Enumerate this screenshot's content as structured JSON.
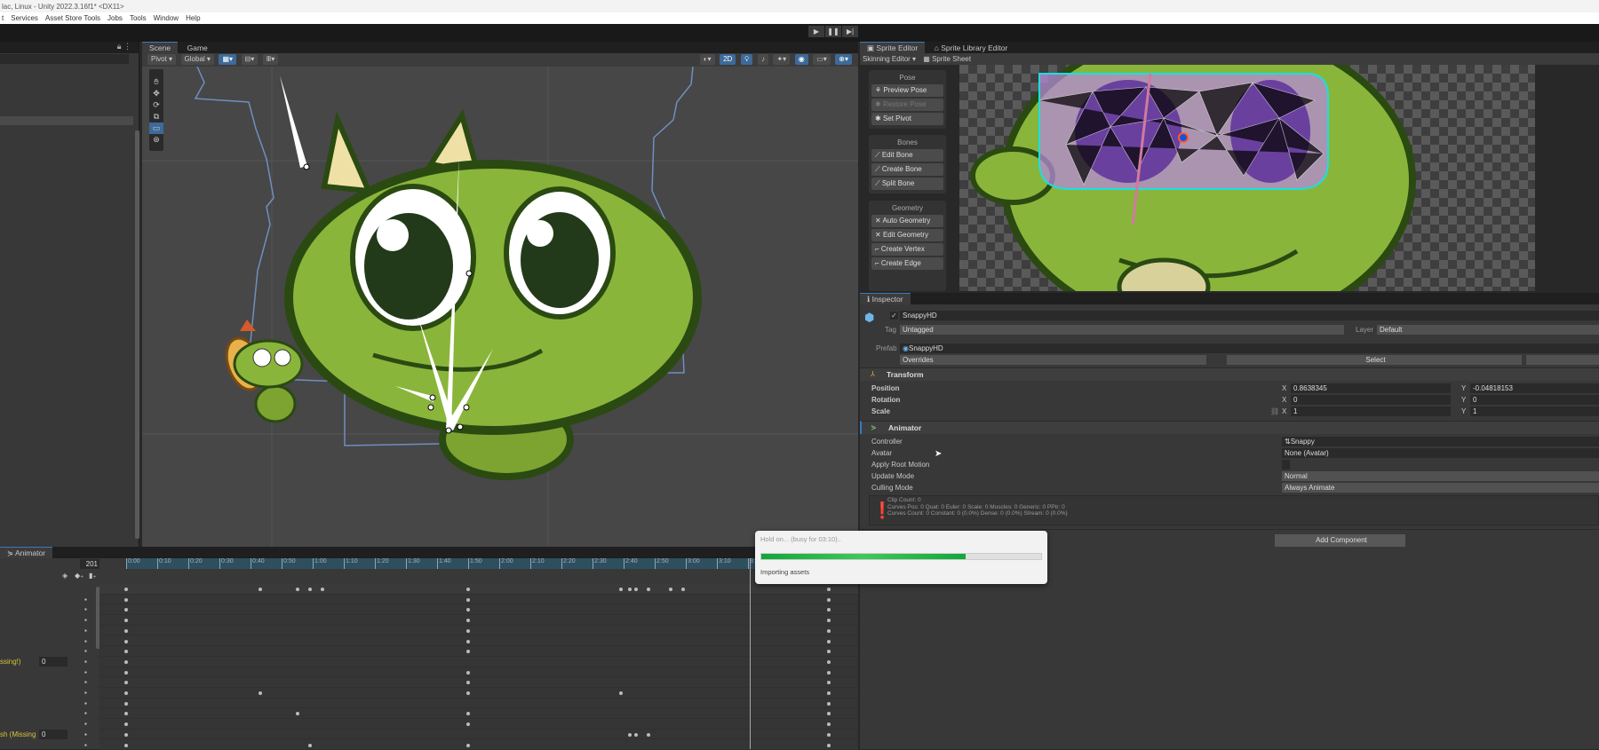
{
  "window": {
    "title": "lac, Linux - Unity 2022.3.16f1* <DX11>"
  },
  "menu": [
    "t",
    "Services",
    "Asset Store Tools",
    "Jobs",
    "Tools",
    "Window",
    "Help"
  ],
  "playback": {
    "play": "▶",
    "pause": "❚❚",
    "step": "▶|"
  },
  "scene": {
    "tabs": [
      "Scene",
      "Game"
    ],
    "pivot": "Pivot ▾",
    "global": "Global ▾",
    "mode2d": "2D"
  },
  "sprite_editor": {
    "tabs": [
      "Sprite Editor",
      "Sprite Library Editor"
    ],
    "mode": "Skinning Editor ▾",
    "sprite_sheet": "Sprite Sheet",
    "groups": [
      {
        "title": "Pose",
        "buttons": [
          {
            "label": "Preview Pose"
          },
          {
            "label": "Restore Pose",
            "disabled": true
          },
          {
            "label": "Set Pivot"
          }
        ]
      },
      {
        "title": "Bones",
        "buttons": [
          {
            "label": "Edit Bone"
          },
          {
            "label": "Create Bone"
          },
          {
            "label": "Split Bone"
          }
        ]
      },
      {
        "title": "Geometry",
        "buttons": [
          {
            "label": "Auto Geometry"
          },
          {
            "label": "Edit Geometry"
          },
          {
            "label": "Create Vertex"
          },
          {
            "label": "Create Edge"
          }
        ]
      }
    ]
  },
  "inspector": {
    "tab": "Inspector",
    "object_name": "SnappyHD",
    "tag_label": "Tag",
    "tag": "Untagged",
    "layer_label": "Layer",
    "layer": "Default",
    "prefab_label": "Prefab",
    "prefab": "SnappyHD",
    "overrides": "Overrides",
    "select": "Select",
    "transform": {
      "title": "Transform",
      "position_label": "Position",
      "rotation_label": "Rotation",
      "scale_label": "Scale",
      "position": {
        "x": "0.8638345",
        "y": "-0.04818153"
      },
      "rotation": {
        "x": "0",
        "y": "0"
      },
      "scale": {
        "x": "1",
        "y": "1"
      }
    },
    "animator": {
      "title": "Animator",
      "controller_label": "Controller",
      "controller": "Snappy",
      "avatar_label": "Avatar",
      "avatar": "None (Avatar)",
      "root_motion_label": "Apply Root Motion",
      "update_label": "Update Mode",
      "update": "Normal",
      "culling_label": "Culling Mode",
      "culling": "Always Animate",
      "info": [
        "Clip Count: 0",
        "Curves Pos: 0 Quat: 0 Euler: 0 Scale: 0 Muscles: 0 Generic: 0 PPtr: 0",
        "Curves Count: 0 Constant: 0 (0.0%) Dense: 0 (0.0%) Stream: 0 (0.0%)"
      ]
    },
    "add_component": "Add Component",
    "axis_x": "X",
    "axis_y": "Y"
  },
  "animation": {
    "tab": "Animator",
    "frame": "201",
    "ticks": [
      "0:00",
      "0:10",
      "0:20",
      "0:30",
      "0:40",
      "0:50",
      "1:00",
      "1:10",
      "1:20",
      "1:30",
      "1:40",
      "1:50",
      "2:00",
      "2:10",
      "2:20",
      "2:30",
      "2:40",
      "2:50",
      "3:00",
      "3:10",
      "3:20"
    ],
    "missing_rows": [
      {
        "label": "ssing!)",
        "value": "0"
      },
      {
        "label": "sh (Missing",
        "value": "0"
      }
    ],
    "keyframes_seconds": [
      [
        0,
        43,
        55,
        59,
        63,
        110,
        159,
        162,
        164,
        168,
        175,
        179,
        226
      ],
      [
        0,
        110,
        226
      ],
      [
        0,
        110,
        226
      ],
      [
        0,
        110,
        226
      ],
      [
        0,
        110,
        226
      ],
      [
        0,
        110,
        226
      ],
      [
        0,
        110,
        226
      ],
      [
        0,
        226
      ],
      [
        0,
        110,
        226
      ],
      [
        0,
        110,
        226
      ],
      [
        0,
        43,
        110,
        159,
        226
      ],
      [
        0,
        226
      ],
      [
        0,
        55,
        110,
        226
      ],
      [
        0,
        110,
        226
      ],
      [
        0,
        162,
        164,
        168,
        226
      ],
      [
        0,
        59,
        110,
        226
      ]
    ]
  },
  "dialog": {
    "title": "Hold on... (busy for 03:10)..",
    "status": "Importing assets",
    "progress": 0.73
  }
}
